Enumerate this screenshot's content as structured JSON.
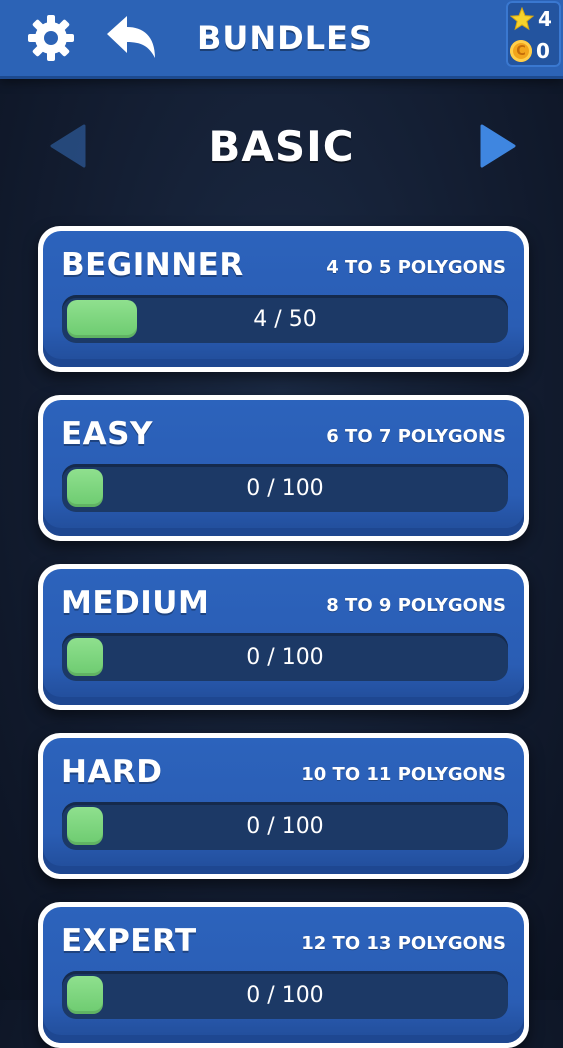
{
  "header": {
    "title": "BUNDLES",
    "settings_icon": "gear-icon",
    "back_icon": "back-arrow-icon",
    "stars": "4",
    "coins": "0",
    "coin_glyph": "C",
    "bar_color": "#2c63b6"
  },
  "category": {
    "title": "BASIC",
    "prev_icon": "triangle-left-icon",
    "next_icon": "triangle-right-icon"
  },
  "bundles": [
    {
      "name": "BEGINNER",
      "range": "4 TO 5 POLYGONS",
      "progress_text": "4 / 50",
      "progress_fraction": 0.08
    },
    {
      "name": "EASY",
      "range": "6 TO 7 POLYGONS",
      "progress_text": "0 / 100",
      "progress_fraction": 0
    },
    {
      "name": "MEDIUM",
      "range": "8 TO 9 POLYGONS",
      "progress_text": "0 / 100",
      "progress_fraction": 0
    },
    {
      "name": "HARD",
      "range": "10 TO 11 POLYGONS",
      "progress_text": "0 / 100",
      "progress_fraction": 0
    },
    {
      "name": "EXPERT",
      "range": "12 TO 13 POLYGONS",
      "progress_text": "0 / 100",
      "progress_fraction": 0
    }
  ],
  "colors": {
    "card_blue": "#2a5db4",
    "progress_green": "#7ad67c",
    "progress_track": "#1c3966",
    "coin_gold": "#f2a51c",
    "star_yellow": "#f6d32c"
  }
}
